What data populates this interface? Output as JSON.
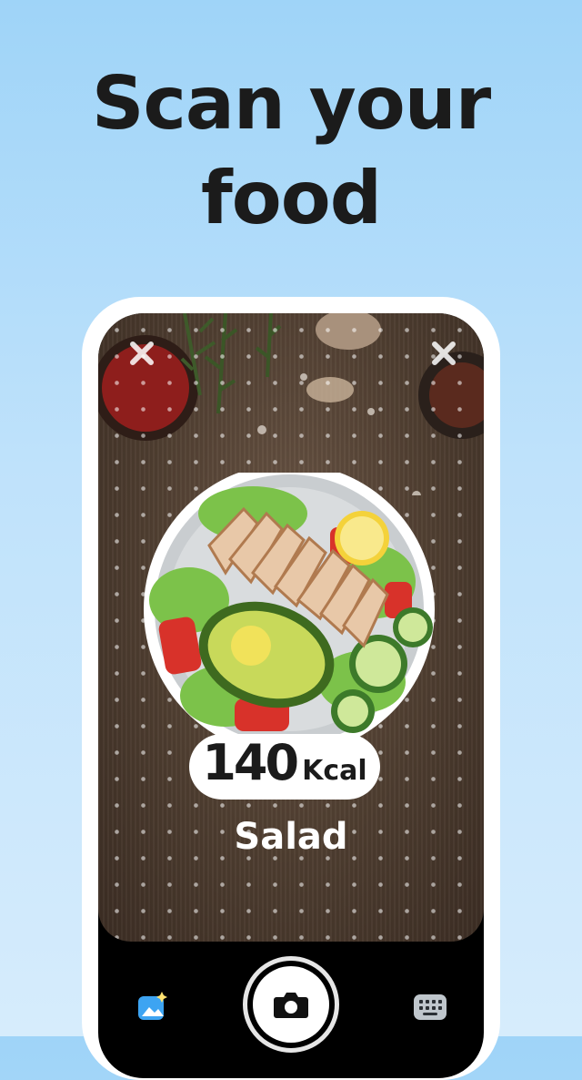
{
  "headline": {
    "line1": "Scan your",
    "line2": "food"
  },
  "result": {
    "calories_value": "140",
    "calories_unit": "Kcal",
    "food_name": "Salad"
  },
  "controls": {
    "gallery_icon": "gallery-sparkle-icon",
    "shutter_icon": "camera-icon",
    "keyboard_icon": "keyboard-icon"
  },
  "colors": {
    "background_top": "#9fd4f8",
    "background_bottom": "#d6ecfc",
    "headline": "#1b1b1b",
    "phone_frame": "#ffffff",
    "gallery_accent": "#3da4f2"
  }
}
